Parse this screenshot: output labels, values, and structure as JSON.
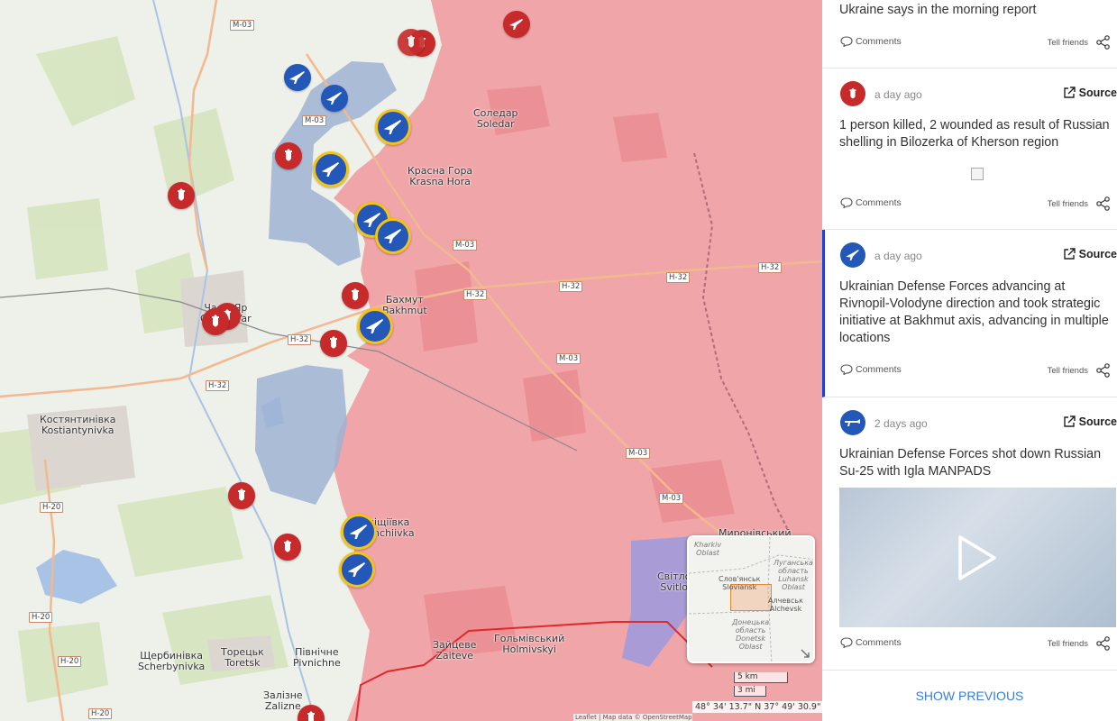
{
  "map": {
    "place_labels": [
      {
        "id": "soledar",
        "text": "Соледар\nSoledar"
      },
      {
        "id": "krasna-hora",
        "text": "Красна Гора\nKrasna Hora"
      },
      {
        "id": "bakhmut",
        "text": "Бахмут\nBakhmut"
      },
      {
        "id": "chasiv-yar",
        "text": "Часів Яр\nChasiv Yar"
      },
      {
        "id": "kostiantynivka",
        "text": "Костянтинівка\nKostiantynivka"
      },
      {
        "id": "klishchiivka",
        "text": "Кліщіївка\nKlishchiivka"
      },
      {
        "id": "toretsk",
        "text": "Торецьк\nToretsk"
      },
      {
        "id": "pivnichne",
        "text": "Північне\nPivnichne"
      },
      {
        "id": "shcherbynivka",
        "text": "Щербинівка\nScherbynivka"
      },
      {
        "id": "zalizne",
        "text": "Залізне\nZalizne"
      },
      {
        "id": "zaitseve",
        "text": "Зайцеве\nZaiteve"
      },
      {
        "id": "holmivskyi",
        "text": "Гольмівський\nHolmivskyi"
      },
      {
        "id": "svitlodarsk",
        "text": "Світло\nSvitlo"
      },
      {
        "id": "myronivskyi",
        "text": "Миронівський"
      }
    ],
    "road_labels": {
      "m03": "M-03",
      "h32": "H-32",
      "h20": "H-20"
    },
    "minimap": {
      "labels": {
        "kharkiv": "Kharkiv\nOblast",
        "sloviansk": "Слов'янськ\nSloviansk",
        "luhansk": "Луганська\nобласть\nLuhansk\nOblast",
        "alchevsk": "Алчевськ\nAlchevsk",
        "donetsk": "Донецька\nобласть\nDonetsk\nOblast"
      }
    },
    "scale": {
      "km": "5 km",
      "mi": "3 mi"
    },
    "coords": "48° 34' 13.7\" N 37° 49' 30.9\" E",
    "attribution": "Leaflet | Map data © OpenStreetMap contributors"
  },
  "feed": {
    "items": [
      {
        "icon": "bomb-icon",
        "title": "Ukraine says in the morning report",
        "comments": "Comments",
        "tell_friends": "Tell friends"
      },
      {
        "icon": "bomb-icon",
        "time": "a day ago",
        "source": "Source",
        "title": "1 person killed, 2 wounded as result of Russian shelling in Bilozerka of Kherson region",
        "comments": "Comments",
        "tell_friends": "Tell friends"
      },
      {
        "icon": "rifle-icon",
        "time": "a day ago",
        "source": "Source",
        "title": "Ukrainian Defense Forces advancing at Rivnopil-Volodyne direction and took strategic initiative at Bakhmut axis, advancing in multiple locations",
        "comments": "Comments",
        "tell_friends": "Tell friends"
      },
      {
        "icon": "manpads-icon",
        "time": "2 days ago",
        "source": "Source",
        "title": "Ukrainian Defense Forces shot down Russian Su-25 with Igla MANPADS",
        "comments": "Comments",
        "tell_friends": "Tell friends"
      }
    ],
    "show_previous": "SHOW PREVIOUS"
  },
  "colors": {
    "occupied": "#f0a5a8",
    "ua_advance": "#9fb3d3",
    "marker_red": "#c62a2a",
    "marker_blue": "#2357b8",
    "marker_ring": "#f5c313",
    "link_blue": "#3a7ed8",
    "active_border": "#1d3fd6"
  }
}
